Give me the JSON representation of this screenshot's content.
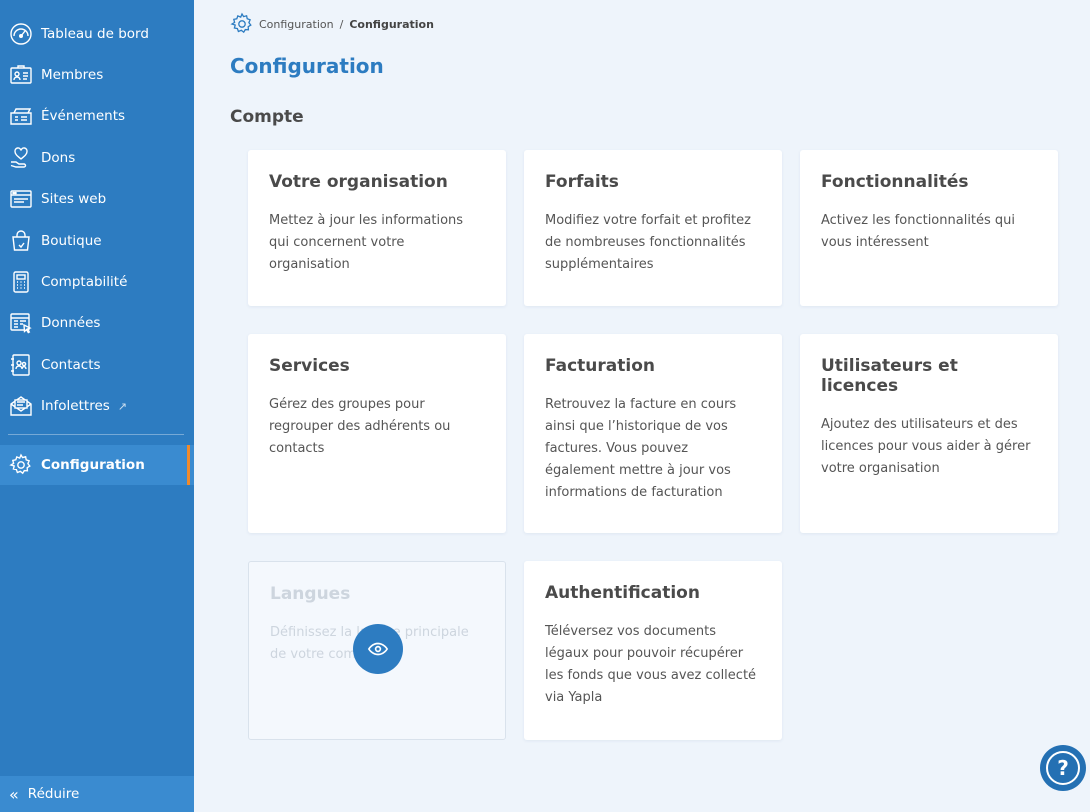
{
  "sidebar": {
    "items": [
      {
        "label": "Tableau de bord",
        "icon": "dashboard-icon"
      },
      {
        "label": "Membres",
        "icon": "members-icon"
      },
      {
        "label": "Événements",
        "icon": "events-icon"
      },
      {
        "label": "Dons",
        "icon": "donations-icon"
      },
      {
        "label": "Sites web",
        "icon": "website-icon"
      },
      {
        "label": "Boutique",
        "icon": "shop-icon"
      },
      {
        "label": "Comptabilité",
        "icon": "accounting-icon"
      },
      {
        "label": "Données",
        "icon": "data-icon"
      },
      {
        "label": "Contacts",
        "icon": "contacts-icon"
      },
      {
        "label": "Infolettres",
        "icon": "newsletter-icon"
      },
      {
        "label": "Configuration",
        "icon": "gear-icon"
      }
    ],
    "collapse_label": "Réduire"
  },
  "breadcrumb": {
    "parent": "Configuration",
    "separator": "/",
    "current": "Configuration"
  },
  "page": {
    "title": "Configuration",
    "section_title": "Compte"
  },
  "cards": [
    {
      "title": "Votre organisation",
      "desc": "Mettez à jour les informations qui concernent votre organisation"
    },
    {
      "title": "Forfaits",
      "desc": "Modifiez votre forfait et profitez de nombreuses fonctionnalités supplémentaires"
    },
    {
      "title": "Fonctionnalités",
      "desc": "Activez les fonctionnalités qui vous intéressent"
    },
    {
      "title": "Services",
      "desc": "Gérez des groupes pour regrouper des adhérents ou contacts"
    },
    {
      "title": "Facturation",
      "desc": "Retrouvez la facture en cours ainsi que l’historique de vos factures. Vous pouvez également mettre à jour vos informations de facturation"
    },
    {
      "title": "Utilisateurs et licences",
      "desc": "Ajoutez des utilisateurs et des licences pour vous aider à gérer votre organisation"
    },
    {
      "title": "Langues",
      "desc": "Définissez la langue principale de votre compte"
    },
    {
      "title": "Authentification",
      "desc": "Téléversez vos documents légaux pour pouvoir récupérer les fonds que vous avez collecté via Yapla"
    }
  ],
  "help": {
    "label": "?"
  },
  "colors": {
    "sidebar": "#2d7cc1",
    "accent": "#2d7cc1",
    "active_marker": "#f08a2c",
    "background": "#eef4fb"
  }
}
